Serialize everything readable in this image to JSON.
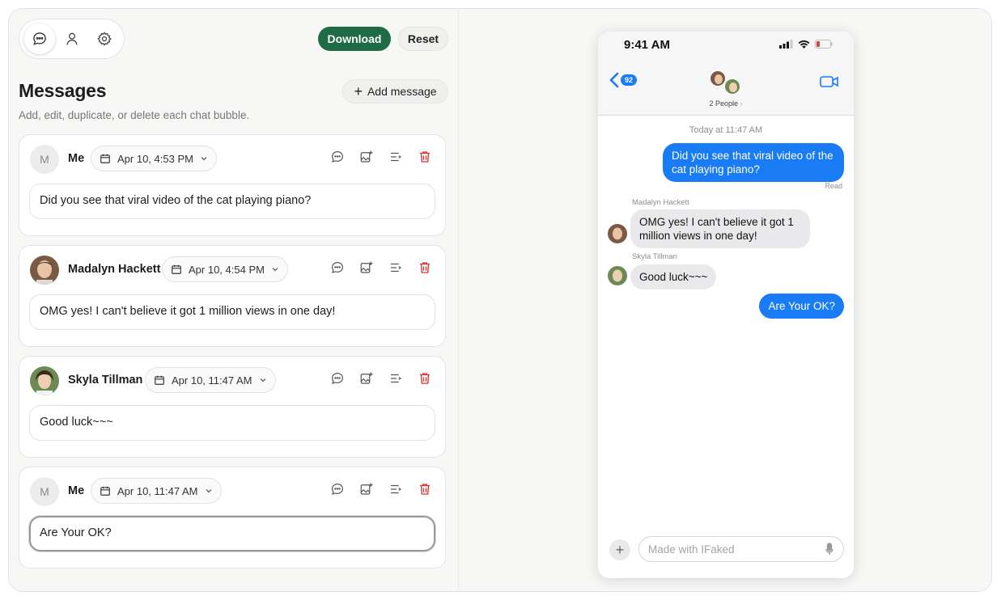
{
  "toolbar": {
    "tabs": [
      {
        "name": "messages",
        "icon": "chat-bubble-icon"
      },
      {
        "name": "people",
        "icon": "person-icon"
      },
      {
        "name": "settings",
        "icon": "gear-icon"
      }
    ],
    "download_label": "Download",
    "reset_label": "Reset",
    "download_color": "#1f6b45"
  },
  "panel": {
    "title": "Messages",
    "subtitle": "Add, edit, duplicate, or delete each chat bubble.",
    "add_label": "Add message"
  },
  "messages": [
    {
      "sender": "Me",
      "avatar": "M",
      "date": "Apr 10, 4:53 PM",
      "text": "Did you see that viral video of the cat playing piano?"
    },
    {
      "sender": "Madalyn Hackett",
      "avatar": "photo",
      "date": "Apr 10, 4:54 PM",
      "text": "OMG yes! I can't believe it got 1 million views in one day!"
    },
    {
      "sender": "Skyla Tillman",
      "avatar": "photo",
      "date": "Apr 10, 11:47 AM",
      "text": "Good luck~~~"
    },
    {
      "sender": "Me",
      "avatar": "M",
      "date": "Apr 10, 11:47 AM",
      "text": "Are Your OK?"
    }
  ],
  "phone": {
    "time": "9:41 AM",
    "back_badge": "92",
    "people_label": "2 People",
    "day_stamp": "Today at 11:47 AM",
    "read_label": "Read",
    "bubbles": [
      {
        "dir": "out",
        "text": "Did you see that viral video of the cat playing piano?"
      },
      {
        "dir": "in",
        "name": "Madalyn Hackett",
        "text": "OMG yes! I can't believe it got 1 million views in one day!"
      },
      {
        "dir": "in",
        "name": "Skyla Tillman",
        "text": "Good luck~~~"
      },
      {
        "dir": "out",
        "text": "Are Your OK?"
      }
    ],
    "composer_placeholder": "Made with IFaked",
    "bubble_blue": "#1a7cf5",
    "bubble_gray": "#e9e9eb"
  }
}
